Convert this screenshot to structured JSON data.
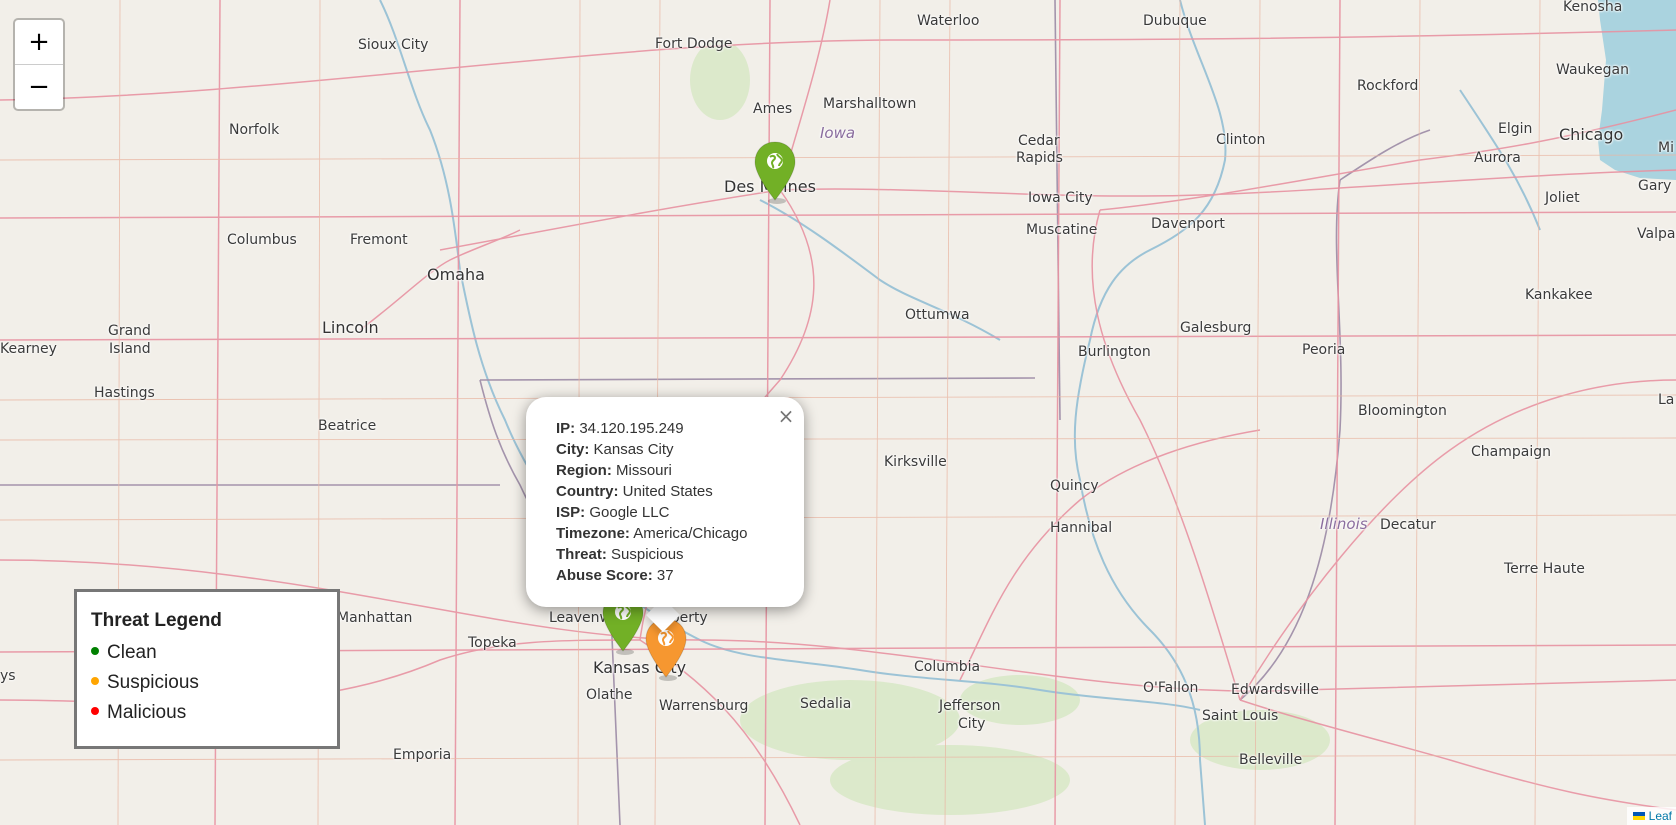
{
  "map": {
    "places": [
      {
        "name": "Waterloo"
      },
      {
        "name": "Dubuque"
      },
      {
        "name": "Kenosha"
      },
      {
        "name": "Sioux City"
      },
      {
        "name": "Fort Dodge"
      },
      {
        "name": "Waukegan"
      },
      {
        "name": "Rockford"
      },
      {
        "name": "Ames"
      },
      {
        "name": "Marshalltown"
      },
      {
        "name": "Iowa"
      },
      {
        "name": "Norfolk"
      },
      {
        "name": "Elgin"
      },
      {
        "name": "Chicago"
      },
      {
        "name": "Cedar"
      },
      {
        "name": "Rapids"
      },
      {
        "name": "Clinton"
      },
      {
        "name": "Aurora"
      },
      {
        "name": "Des Moines"
      },
      {
        "name": "Iowa City"
      },
      {
        "name": "Gary"
      },
      {
        "name": "Joliet"
      },
      {
        "name": "Columbus"
      },
      {
        "name": "Fremont"
      },
      {
        "name": "Muscatine"
      },
      {
        "name": "Davenport"
      },
      {
        "name": "Valpar"
      },
      {
        "name": "Omaha"
      },
      {
        "name": "Kankakee"
      },
      {
        "name": "Ottumwa"
      },
      {
        "name": "Grand"
      },
      {
        "name": "Island"
      },
      {
        "name": "Lincoln"
      },
      {
        "name": "Galesburg"
      },
      {
        "name": "Kearney"
      },
      {
        "name": "Burlington"
      },
      {
        "name": "Peoria"
      },
      {
        "name": "Hastings"
      },
      {
        "name": "La"
      },
      {
        "name": "Bloomington"
      },
      {
        "name": "Beatrice"
      },
      {
        "name": "Champaign"
      },
      {
        "name": "Kirksville"
      },
      {
        "name": "Quincy"
      },
      {
        "name": "Illinois"
      },
      {
        "name": "Decatur"
      },
      {
        "name": "Hannibal"
      },
      {
        "name": "Terre Haute"
      },
      {
        "name": "Manhattan"
      },
      {
        "name": "Leavenworth"
      },
      {
        "name": "Liberty"
      },
      {
        "name": "Topeka"
      },
      {
        "name": "Kansas City"
      },
      {
        "name": "Columbia"
      },
      {
        "name": "O'Fallon"
      },
      {
        "name": "Edwardsville"
      },
      {
        "name": "Olathe"
      },
      {
        "name": "Warrensburg"
      },
      {
        "name": "Sedalia"
      },
      {
        "name": "Jefferson"
      },
      {
        "name": "City"
      },
      {
        "name": "Saint Louis"
      },
      {
        "name": "Belleville"
      },
      {
        "name": "Emporia"
      },
      {
        "name": "ys"
      },
      {
        "name": "Mi"
      }
    ],
    "markers": [
      {
        "threat": "Clean",
        "color": "#72b026"
      },
      {
        "threat": "Clean",
        "color": "#72b026"
      },
      {
        "threat": "Suspicious",
        "color": "#f69730"
      }
    ]
  },
  "zoom": {
    "in": "+",
    "out": "−"
  },
  "popup": {
    "rows": [
      {
        "key": "IP:",
        "value": "34.120.195.249"
      },
      {
        "key": "City:",
        "value": "Kansas City"
      },
      {
        "key": "Region:",
        "value": "Missouri"
      },
      {
        "key": "Country:",
        "value": "United States"
      },
      {
        "key": "ISP:",
        "value": "Google LLC"
      },
      {
        "key": "Timezone:",
        "value": "America/Chicago"
      },
      {
        "key": "Threat:",
        "value": "Suspicious"
      },
      {
        "key": "Abuse Score:",
        "value": "37"
      }
    ],
    "close": "×"
  },
  "legend": {
    "title": "Threat Legend",
    "items": [
      {
        "label": "Clean",
        "color": "#008000"
      },
      {
        "label": "Suspicious",
        "color": "#ffa500"
      },
      {
        "label": "Malicious",
        "color": "#ff0000"
      }
    ]
  },
  "attribution": "Leaf"
}
